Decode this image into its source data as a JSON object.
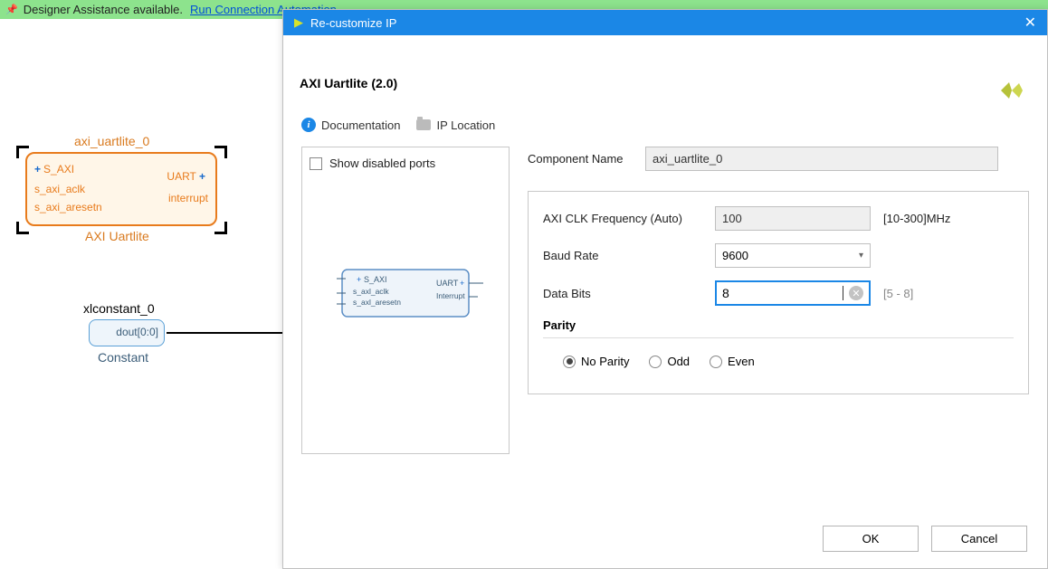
{
  "banner": {
    "text": "Designer Assistance available.",
    "link": "Run Connection Automation"
  },
  "canvas": {
    "uartlite": {
      "title": "axi_uartlite_0",
      "ports_left": [
        "S_AXI",
        "s_axi_aclk",
        "s_axi_aresetn"
      ],
      "ports_right": [
        "UART",
        "interrupt"
      ],
      "caption": "AXI Uartlite"
    },
    "constant": {
      "title": "xlconstant_0",
      "port": "dout[0:0]",
      "caption": "Constant"
    }
  },
  "dialog": {
    "title": "Re-customize IP",
    "headline": "AXI Uartlite (2.0)",
    "toolbar": {
      "doc": "Documentation",
      "loc": "IP Location"
    },
    "left": {
      "show_disabled": "Show disabled ports",
      "preview": {
        "ports_left": [
          "S_AXI",
          "s_axl_aclk",
          "s_axl_aresetn"
        ],
        "ports_right": [
          "UART",
          "Interrupt"
        ]
      }
    },
    "right": {
      "component_name_label": "Component Name",
      "component_name_value": "axi_uartlite_0",
      "axi_clk_label": "AXI CLK Frequency (Auto)",
      "axi_clk_value": "100",
      "axi_clk_hint": "[10-300]MHz",
      "baud_label": "Baud Rate",
      "baud_value": "9600",
      "databits_label": "Data Bits",
      "databits_value": "8",
      "databits_hint": "[5 - 8]",
      "parity_label": "Parity",
      "parity_options": {
        "none": "No Parity",
        "odd": "Odd",
        "even": "Even"
      }
    },
    "buttons": {
      "ok": "OK",
      "cancel": "Cancel"
    }
  }
}
